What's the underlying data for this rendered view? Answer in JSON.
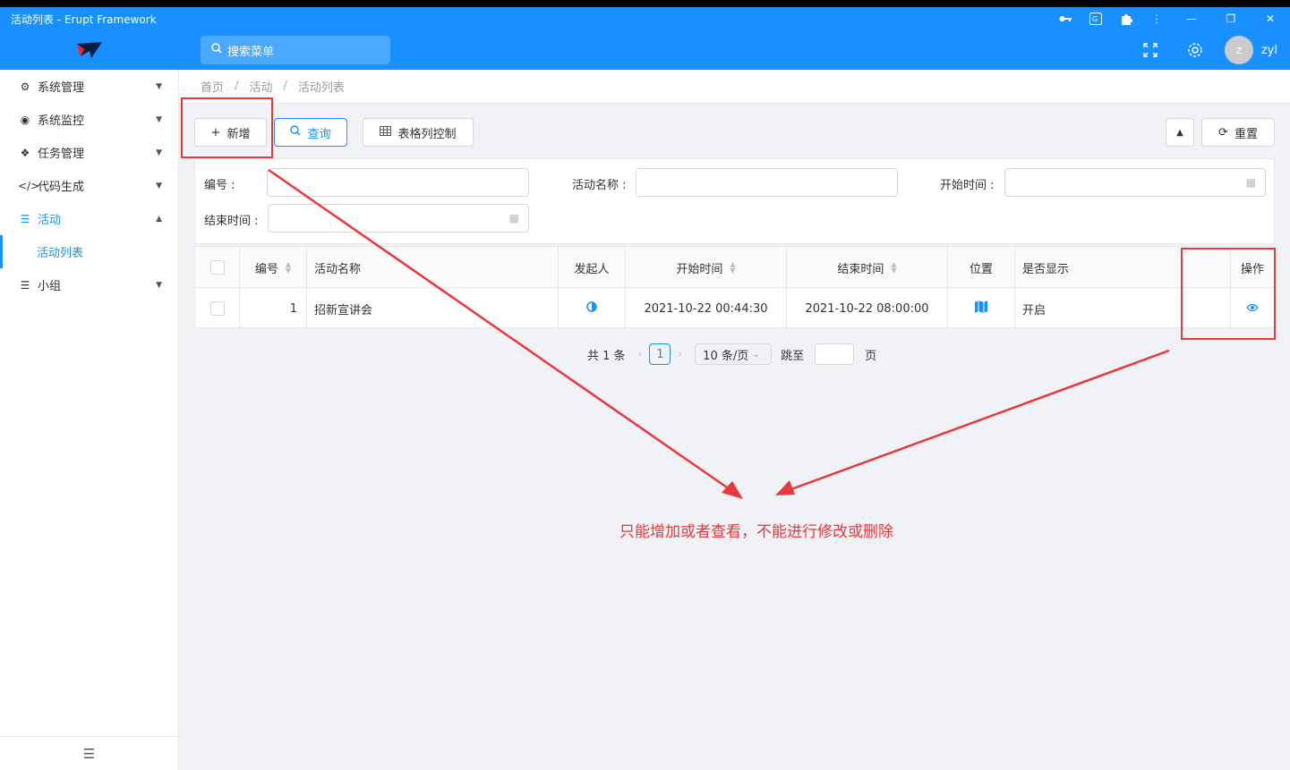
{
  "window": {
    "title": "活动列表 - Erupt Framework",
    "icons": [
      "key-icon",
      "translate-icon",
      "puzzle-icon",
      "more-vertical-icon"
    ],
    "controls": [
      "minimize-icon",
      "restore-icon",
      "close-icon"
    ]
  },
  "header": {
    "search_placeholder": "搜索菜单",
    "avatar_letter": "z",
    "username": "zyl"
  },
  "sidebar": {
    "items": [
      {
        "label": "系统管理",
        "icon": "gears-icon"
      },
      {
        "label": "系统监控",
        "icon": "monitor-icon"
      },
      {
        "label": "任务管理",
        "icon": "cubes-icon"
      },
      {
        "label": "代码生成",
        "icon": "code-icon"
      },
      {
        "label": "活动",
        "icon": "list-icon"
      },
      {
        "label": "小组",
        "icon": "list-icon"
      }
    ],
    "sub_item": "活动列表"
  },
  "breadcrumb": [
    "首页",
    "活动",
    "活动列表"
  ],
  "toolbar": {
    "add": "新增",
    "query": "查询",
    "columns": "表格列控制",
    "reset": "重置"
  },
  "form": {
    "id_label": "编号 :",
    "name_label": "活动名称 :",
    "start_label": "开始时间 :",
    "end_label": "结束时间 :"
  },
  "table": {
    "headers": [
      "编号",
      "活动名称",
      "发起人",
      "开始时间",
      "结束时间",
      "位置",
      "是否显示",
      "操作"
    ],
    "rows": [
      {
        "id": "1",
        "name": "招新宣讲会",
        "start": "2021-10-22 00:44:30",
        "end": "2021-10-22 08:00:00",
        "show": "开启"
      }
    ]
  },
  "pagination": {
    "total": "共 1 条",
    "current": "1",
    "page_size": "10 条/页",
    "jump_label": "跳至",
    "page_unit": "页"
  },
  "annotation": {
    "text": "只能增加或者查看，不能进行修改或删除",
    "color": "#e8383d"
  },
  "colors": {
    "primary": "#1890ff"
  }
}
